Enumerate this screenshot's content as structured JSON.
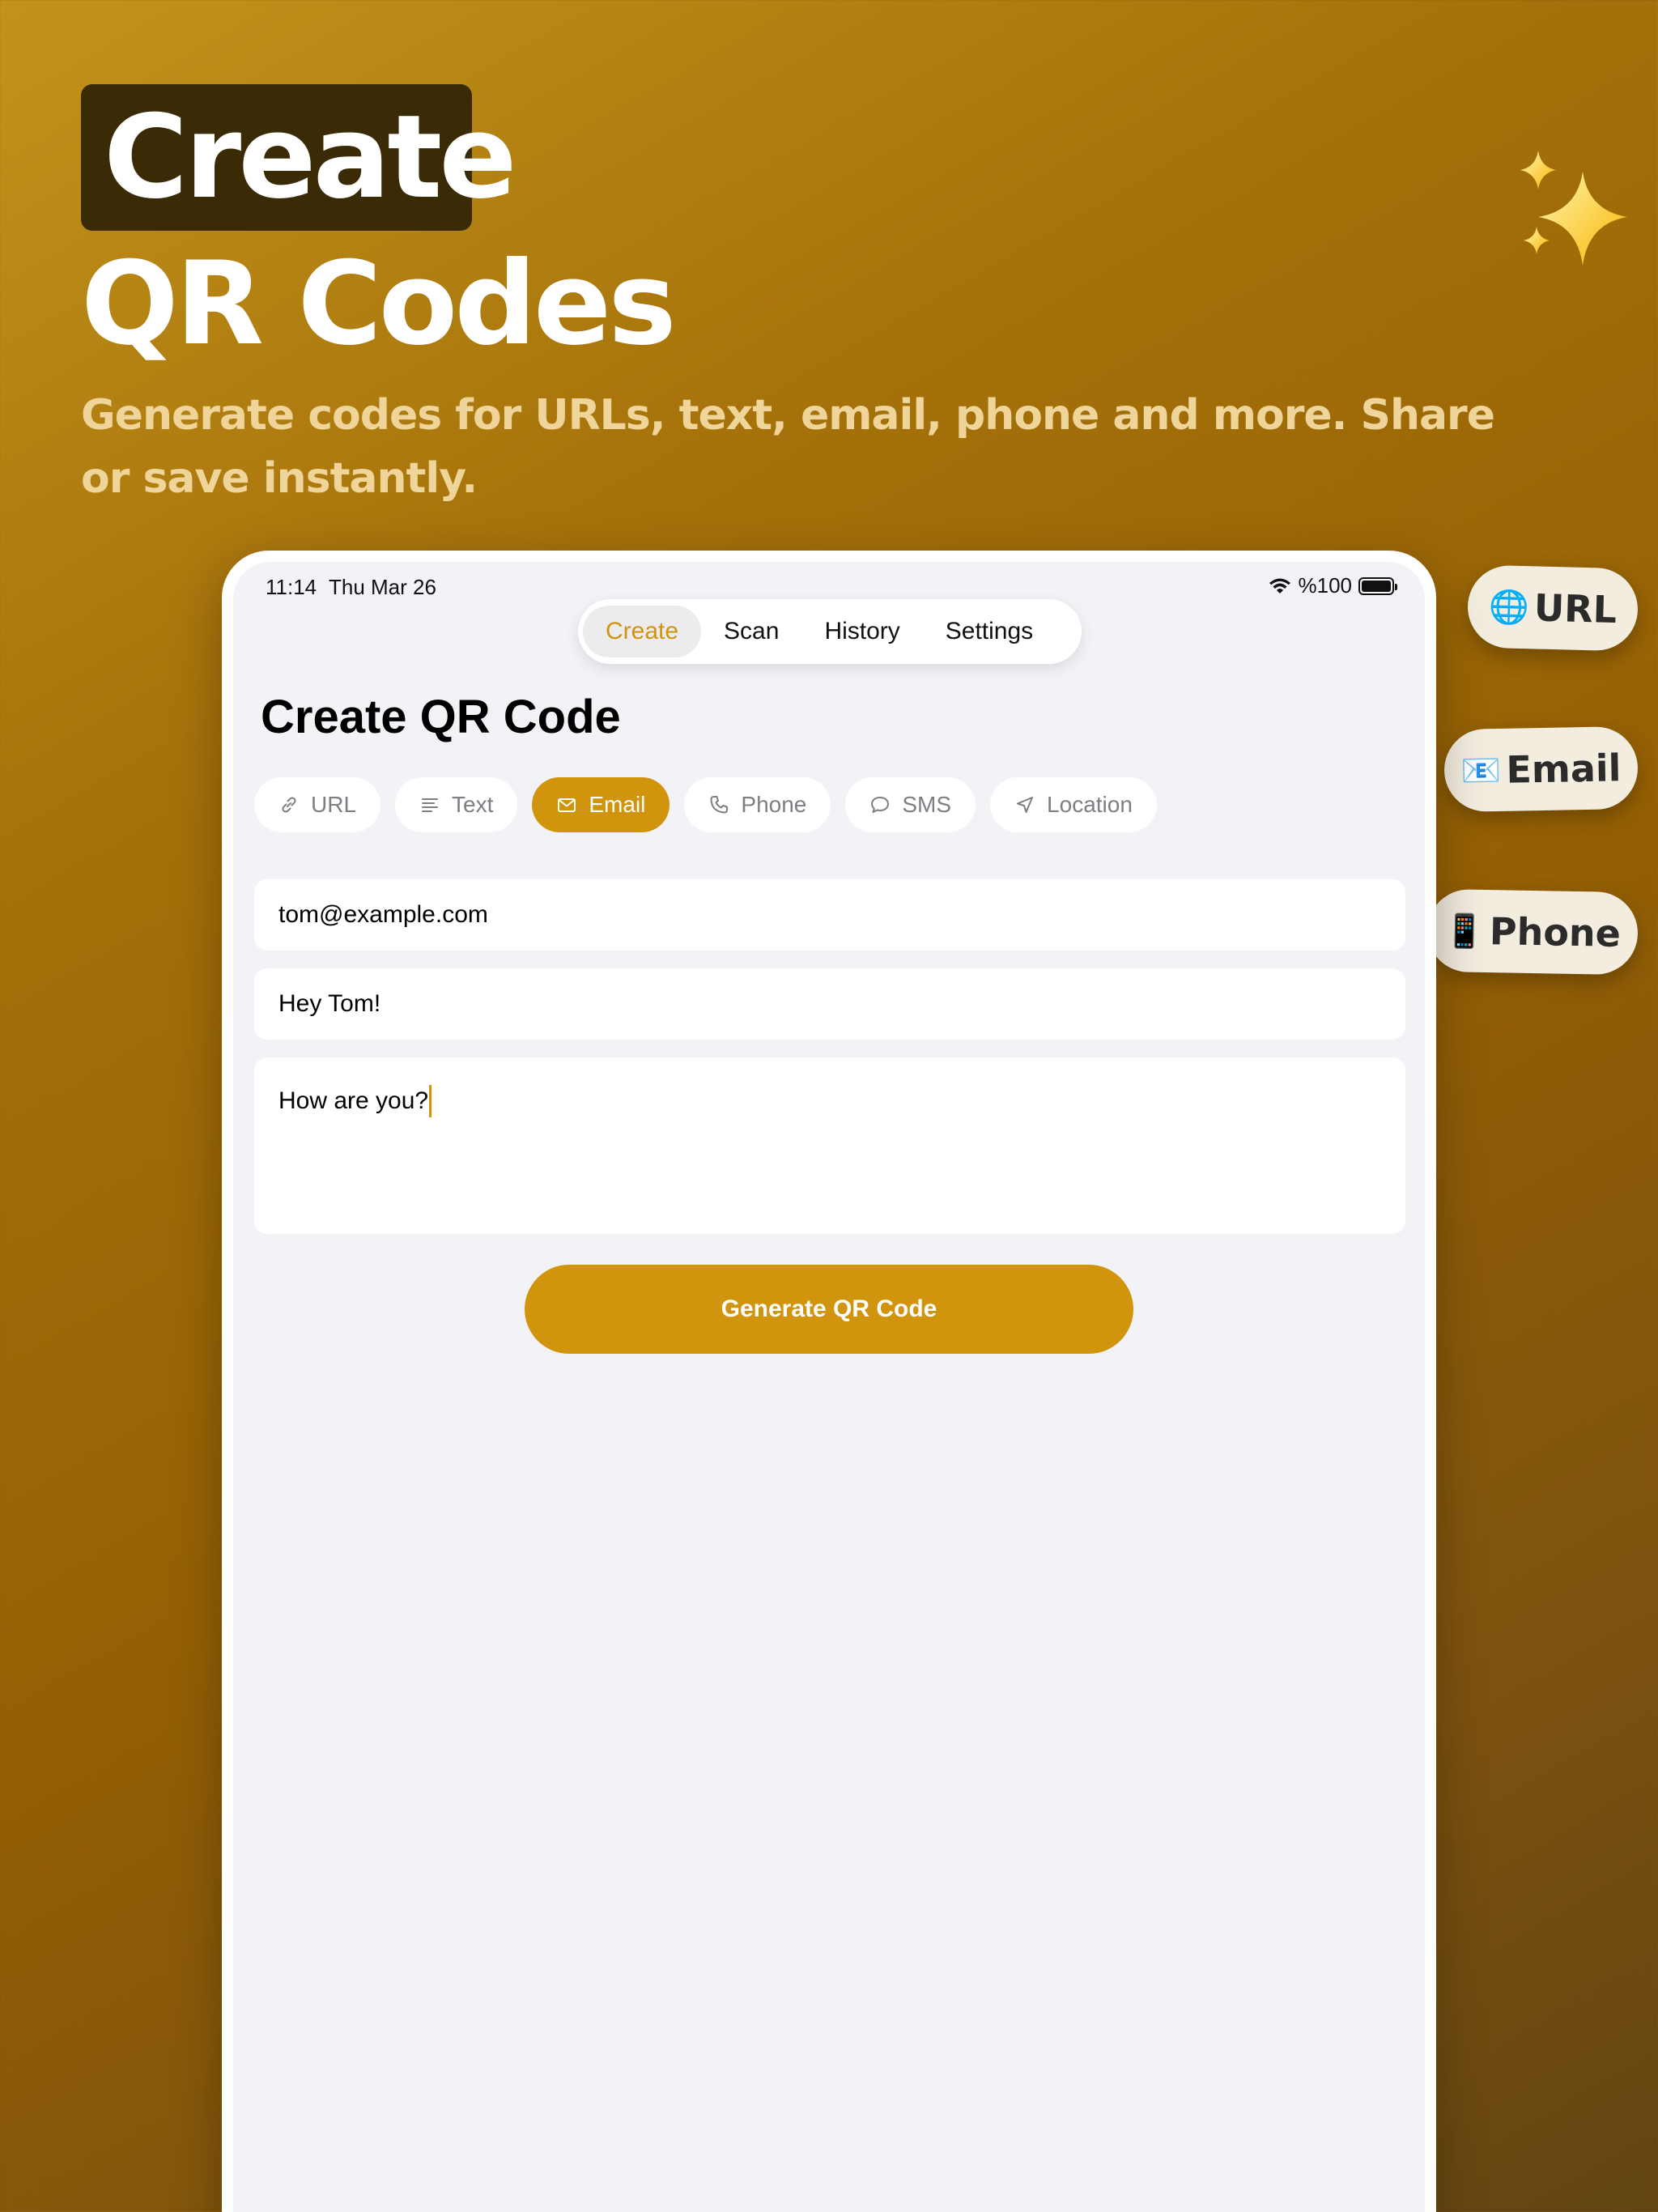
{
  "hero": {
    "title_line1": "Create",
    "title_line2": "QR Codes",
    "subtitle": "Generate codes for URLs, text, email, phone and more. Share or save instantly."
  },
  "floating_chips": [
    {
      "emoji": "🌐",
      "label": "URL"
    },
    {
      "emoji": "📧",
      "label": "Email"
    },
    {
      "emoji": "📱",
      "label": "Phone"
    }
  ],
  "status_bar": {
    "time": "11:14",
    "date": "Thu Mar 26",
    "battery": "%100"
  },
  "nav": {
    "tabs": [
      "Create",
      "Scan",
      "History",
      "Settings"
    ],
    "active": "Create"
  },
  "page": {
    "title": "Create QR Code"
  },
  "content_types": [
    {
      "label": "URL",
      "icon": "link-icon"
    },
    {
      "label": "Text",
      "icon": "text-lines-icon"
    },
    {
      "label": "Email",
      "icon": "envelope-icon",
      "active": true
    },
    {
      "label": "Phone",
      "icon": "phone-icon"
    },
    {
      "label": "SMS",
      "icon": "chat-bubble-icon"
    },
    {
      "label": "Location",
      "icon": "location-arrow-icon"
    }
  ],
  "form": {
    "email": "tom@example.com",
    "subject": "Hey Tom!",
    "body": "How are you?"
  },
  "actions": {
    "generate_label": "Generate QR Code"
  },
  "colors": {
    "accent": "#d0950c",
    "background_top": "#c2931b",
    "background_bottom": "#624512",
    "title_box": "#3a2a05"
  }
}
